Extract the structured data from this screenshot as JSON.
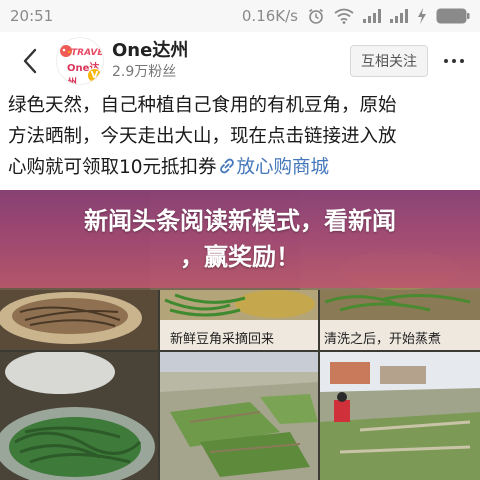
{
  "status_bar": {
    "time": "20:51",
    "network_speed": "0.16K/s",
    "icons": [
      "alarm-icon",
      "wifi-icon",
      "signal-icon",
      "signal-icon",
      "charging-icon",
      "battery-icon"
    ]
  },
  "header": {
    "back_icon": "chevron-left-icon",
    "avatar_logo_text": "TRAVEL",
    "avatar_logo_sub": "One达州",
    "verified_mark": "V",
    "account_name": "One达州",
    "followers": "2.9万粉丝",
    "follow_label": "互相关注",
    "more_icon": "more-dots-icon"
  },
  "article": {
    "line1": "绿色天然，自己种植自己食用的有机豆角，原始",
    "line2": "方法晒制，今天走出大山，现在点击链接进入放",
    "line3_text": "心购就可领取10元抵扣券",
    "link_icon": "link-icon",
    "link_text": "放心购商城"
  },
  "photos": {
    "caption_left": "新鲜豆角采摘回来",
    "caption_right": "清洗之后，开始蒸煮"
  },
  "promo": {
    "line1": "新闻头条阅读新模式，看新闻",
    "line2": "，赢奖励！"
  },
  "colors": {
    "status_bg": "#f7f7f7",
    "link": "#4477bb",
    "promo_overlay": "#a64676",
    "verified": "#f5b50a"
  }
}
